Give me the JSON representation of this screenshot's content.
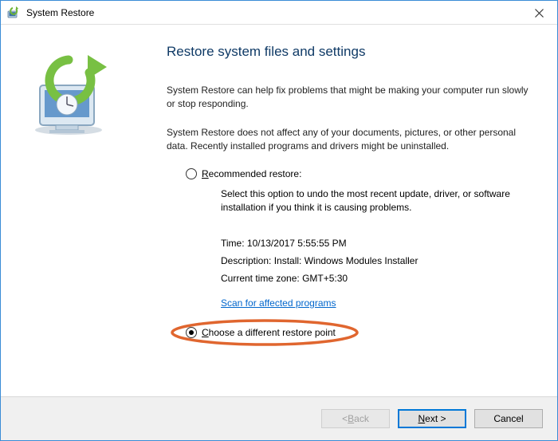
{
  "titlebar": {
    "title": "System Restore"
  },
  "heading": "Restore system files and settings",
  "para1": "System Restore can help fix problems that might be making your computer run slowly or stop responding.",
  "para2": "System Restore does not affect any of your documents, pictures, or other personal data. Recently installed programs and drivers might be uninstalled.",
  "option_recommended": {
    "label_prefix": "R",
    "label_rest": "ecommended restore:",
    "desc": "Select this option to undo the most recent update, driver, or software installation if you think it is causing problems.",
    "time_label": "Time:",
    "time_value": "10/13/2017 5:55:55 PM",
    "desc_label": "Description:",
    "desc_value": "Install: Windows Modules Installer",
    "tz_label": "Current time zone:",
    "tz_value": "GMT+5:30",
    "scan_link": "Scan for affected programs"
  },
  "option_choose": {
    "label_prefix": "C",
    "label_rest": "hoose a different restore point"
  },
  "footer": {
    "back_prefix": "< ",
    "back_mn": "B",
    "back_rest": "ack",
    "next_mn": "N",
    "next_rest": "ext >",
    "cancel": "Cancel"
  }
}
